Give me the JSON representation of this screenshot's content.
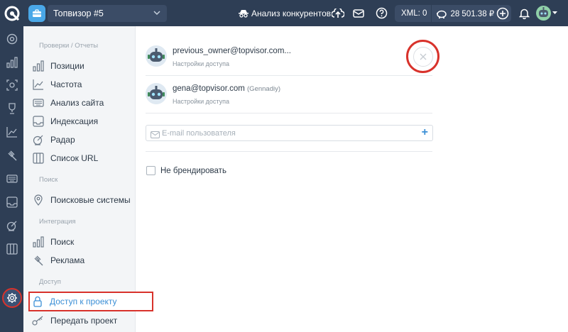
{
  "topbar": {
    "project_name": "Топвизор #5",
    "competitors_label": "Анализ конкурентов",
    "xml_label": "XML: 0",
    "balance": "28 501.38 ₽"
  },
  "sidebar": {
    "sections": [
      {
        "title": "Проверки / Отчеты"
      },
      {
        "title": "Поиск"
      },
      {
        "title": "Интеграция"
      },
      {
        "title": "Доступ"
      }
    ],
    "items": [
      {
        "label": "Позиции",
        "icon": "bars-chart-icon"
      },
      {
        "label": "Частота",
        "icon": "trend-line-icon"
      },
      {
        "label": "Анализ сайта",
        "icon": "site-audit-icon"
      },
      {
        "label": "Индексация",
        "icon": "inbox-icon"
      },
      {
        "label": "Радар",
        "icon": "radar-icon"
      },
      {
        "label": "Список URL",
        "icon": "columns-icon"
      },
      {
        "label": "Поисковые системы",
        "icon": "location-pin-icon"
      },
      {
        "label": "Поиск",
        "icon": "bars-chart-icon"
      },
      {
        "label": "Реклама",
        "icon": "gavel-icon"
      },
      {
        "label": "Доступ к проекту",
        "icon": "lock-icon"
      },
      {
        "label": "Передать проект",
        "icon": "key-icon"
      }
    ]
  },
  "users": [
    {
      "email": "previous_owner@topvisor.com...",
      "nick": "",
      "subtitle": "Настройки доступа"
    },
    {
      "email": "gena@topvisor.com",
      "nick": "(Gennadiy)",
      "subtitle": "Настройки доступа"
    }
  ],
  "email_field": {
    "placeholder": "E-mail пользователя",
    "value": ""
  },
  "no_branding_label": "Не брендировать",
  "colors": {
    "accent": "#3b8fd6",
    "highlight": "#d8322b",
    "dark": "#2e3e55"
  }
}
